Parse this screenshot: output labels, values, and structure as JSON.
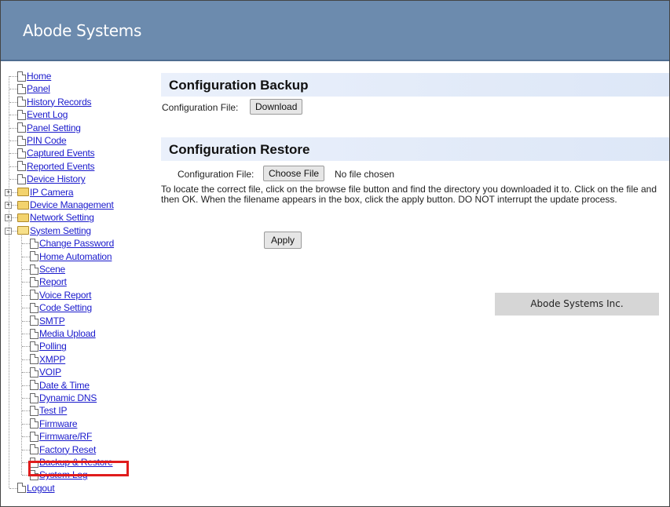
{
  "header": {
    "brand": "Abode Systems"
  },
  "sidebar": {
    "items": [
      {
        "label": "Home",
        "type": "page"
      },
      {
        "label": "Panel",
        "type": "page"
      },
      {
        "label": "History Records",
        "type": "page"
      },
      {
        "label": "Event Log",
        "type": "page"
      },
      {
        "label": "Panel Setting",
        "type": "page"
      },
      {
        "label": "PIN Code",
        "type": "page"
      },
      {
        "label": "Captured Events",
        "type": "page"
      },
      {
        "label": "Reported Events",
        "type": "page"
      },
      {
        "label": "Device History",
        "type": "page"
      },
      {
        "label": "IP Camera",
        "type": "folder"
      },
      {
        "label": "Device Management",
        "type": "folder"
      },
      {
        "label": "Network Setting",
        "type": "folder"
      },
      {
        "label": "System Setting",
        "type": "folder-open"
      },
      {
        "label": "Change Password",
        "type": "subpage"
      },
      {
        "label": "Home Automation",
        "type": "subpage"
      },
      {
        "label": "Scene",
        "type": "subpage"
      },
      {
        "label": "Report",
        "type": "subpage"
      },
      {
        "label": "Voice Report",
        "type": "subpage"
      },
      {
        "label": "Code Setting",
        "type": "subpage"
      },
      {
        "label": "SMTP",
        "type": "subpage"
      },
      {
        "label": "Media Upload",
        "type": "subpage"
      },
      {
        "label": "Polling",
        "type": "subpage"
      },
      {
        "label": "XMPP",
        "type": "subpage"
      },
      {
        "label": "VOIP",
        "type": "subpage"
      },
      {
        "label": "Date & Time",
        "type": "subpage"
      },
      {
        "label": "Dynamic DNS",
        "type": "subpage"
      },
      {
        "label": "Test IP",
        "type": "subpage"
      },
      {
        "label": "Firmware",
        "type": "subpage"
      },
      {
        "label": "Firmware/RF",
        "type": "subpage"
      },
      {
        "label": "Factory Reset",
        "type": "subpage"
      },
      {
        "label": "Backup & Restore",
        "type": "subpage",
        "highlighted": true
      },
      {
        "label": "System Log",
        "type": "subpage"
      },
      {
        "label": "Logout",
        "type": "page"
      }
    ]
  },
  "backup": {
    "title": "Configuration Backup",
    "file_label": "Configuration File:",
    "download_label": "Download"
  },
  "restore": {
    "title": "Configuration Restore",
    "file_label": "Configuration File:",
    "choose_label": "Choose File",
    "no_file_text": "No file chosen",
    "help_text": "To locate the correct file, click on the browse file button and find the directory you downloaded it to. Click on the file and then OK. When the filename appears in the box, click the apply button. DO NOT interrupt the update process.",
    "apply_label": "Apply"
  },
  "footer": {
    "company": "Abode Systems Inc."
  },
  "colors": {
    "header": "#6c8bae",
    "highlight": "#e01c1c",
    "link": "#1a1acc"
  }
}
